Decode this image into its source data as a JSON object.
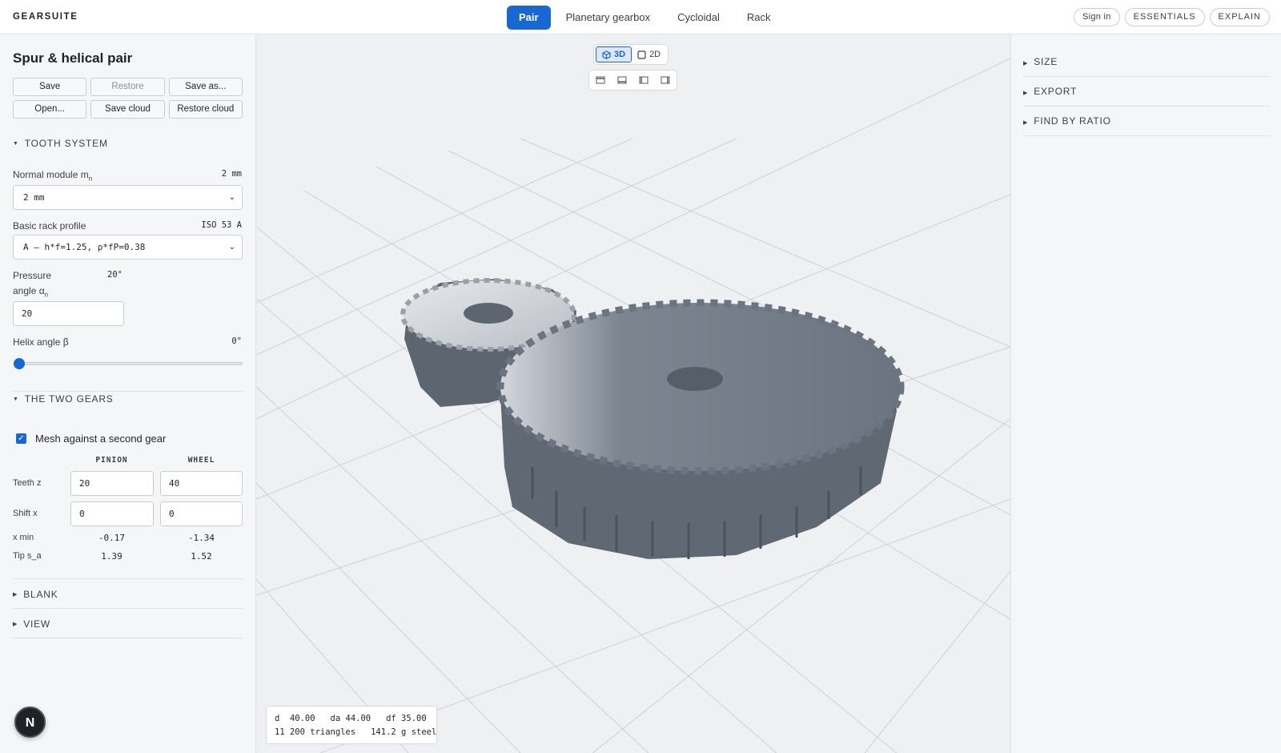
{
  "app": {
    "brand": "GEARSUITE"
  },
  "tabs": [
    {
      "label": "Pair",
      "active": true
    },
    {
      "label": "Planetary gearbox",
      "active": false
    },
    {
      "label": "Cycloidal",
      "active": false
    },
    {
      "label": "Rack",
      "active": false
    }
  ],
  "topright": {
    "signin": "Sign in",
    "essentials": "ESSENTIALS",
    "explain": "EXPLAIN"
  },
  "sidebar": {
    "title": "Spur & helical pair",
    "buttons": {
      "save": "Save",
      "restore": "Restore",
      "save_as": "Save as...",
      "open": "Open...",
      "save_cloud": "Save cloud",
      "restore_cloud": "Restore cloud"
    },
    "tooth_system": {
      "heading": "TOOTH SYSTEM",
      "module_label": "Normal module m",
      "module_sub": "n",
      "module_value": "2 mm",
      "module_select": "2 mm",
      "rack_label": "Basic rack profile",
      "rack_value": "ISO 53 A",
      "rack_select": "A — h*f=1.25, ρ*fP=0.38",
      "pressure_label_1": "Pressure",
      "pressure_label_2": "angle α",
      "pressure_sub": "n",
      "pressure_value": "20°",
      "pressure_input": "20",
      "helix_label": "Helix angle β",
      "helix_value": "0°",
      "helix_slider_fraction": 0
    },
    "two_gears": {
      "heading": "THE TWO GEARS",
      "mesh_label": "Mesh against a second gear",
      "mesh_checked": true,
      "col_pinion": "PINION",
      "col_wheel": "WHEEL",
      "teeth_label": "Teeth z",
      "teeth_pinion": "20",
      "teeth_wheel": "40",
      "shift_label": "Shift x",
      "shift_pinion": "0",
      "shift_wheel": "0",
      "xmin_label": "x min",
      "xmin_pinion": "-0.17",
      "xmin_wheel": "-1.34",
      "tip_label": "Tip s_a",
      "tip_pinion": "1.39",
      "tip_wheel": "1.52"
    },
    "blank_heading": "BLANK",
    "view_heading": "VIEW",
    "avatar_letter": "N"
  },
  "viewport": {
    "mode_3d": "3D",
    "mode_2d": "2D",
    "mode_active": "3D",
    "readout_line1": "d  40.00   da 44.00   df 35.00",
    "readout_line2": "11 200 triangles   141.2 g steel"
  },
  "rightpanel": {
    "size": "SIZE",
    "export": "EXPORT",
    "find_by_ratio": "FIND BY RATIO"
  },
  "colors": {
    "accent": "#1868d4",
    "gear": "#6b7480"
  }
}
